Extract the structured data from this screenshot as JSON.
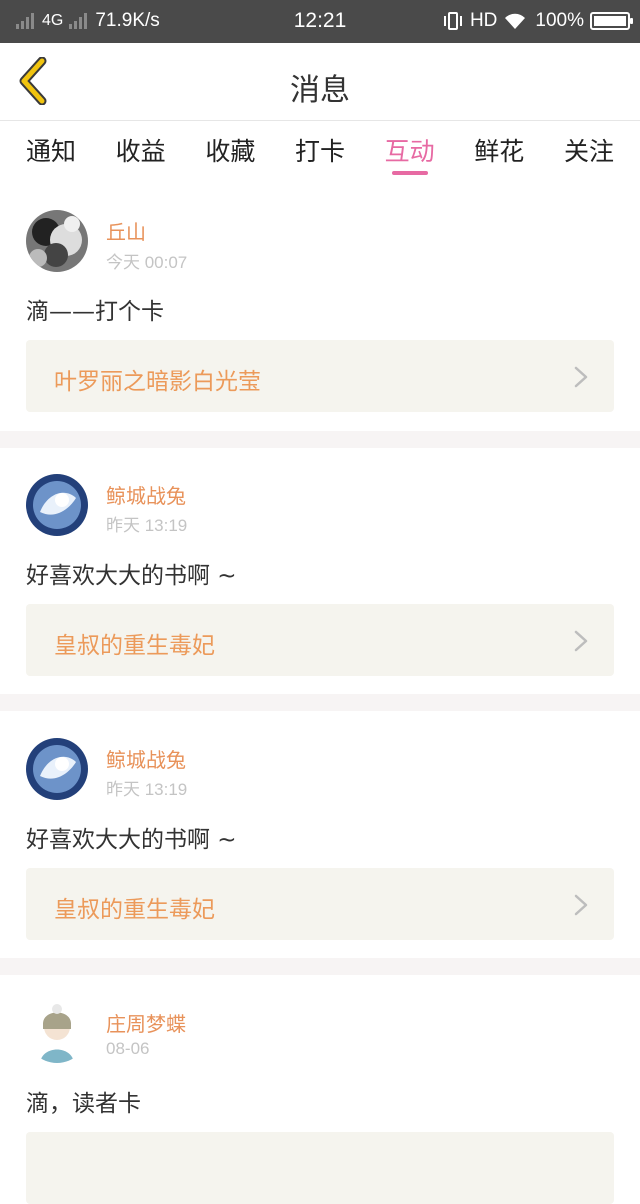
{
  "status_bar": {
    "network": "4G",
    "speed": "71.9K/s",
    "time": "12:21",
    "hd": "HD",
    "battery": "100%"
  },
  "header": {
    "title": "消息",
    "back_icon": "chevron-left-icon"
  },
  "tabs": [
    {
      "label": "通知"
    },
    {
      "label": "收益"
    },
    {
      "label": "收藏"
    },
    {
      "label": "打卡"
    },
    {
      "label": "互动",
      "active": true
    },
    {
      "label": "鲜花"
    },
    {
      "label": "关注"
    }
  ],
  "feed": [
    {
      "user": "丘山",
      "time": "今天 00:07",
      "message": "滴——打个卡",
      "book": "叶罗丽之暗影白光莹"
    },
    {
      "user": "鲸城战兔",
      "time": "昨天 13:19",
      "message": "好喜欢大大的书啊 ~",
      "book": "皇叔的重生毒妃"
    },
    {
      "user": "鲸城战兔",
      "time": "昨天 13:19",
      "message": "好喜欢大大的书啊 ~",
      "book": "皇叔的重生毒妃"
    },
    {
      "user": "庄周梦蝶",
      "time": "08-06",
      "message": "滴，读者卡",
      "book": ""
    }
  ],
  "colors": {
    "accent": "#e76aa3",
    "username": "#e8925a",
    "book_title": "#ec9a5a",
    "book_bg": "#f5f4ee",
    "back_arrow": "#f1c40f"
  }
}
